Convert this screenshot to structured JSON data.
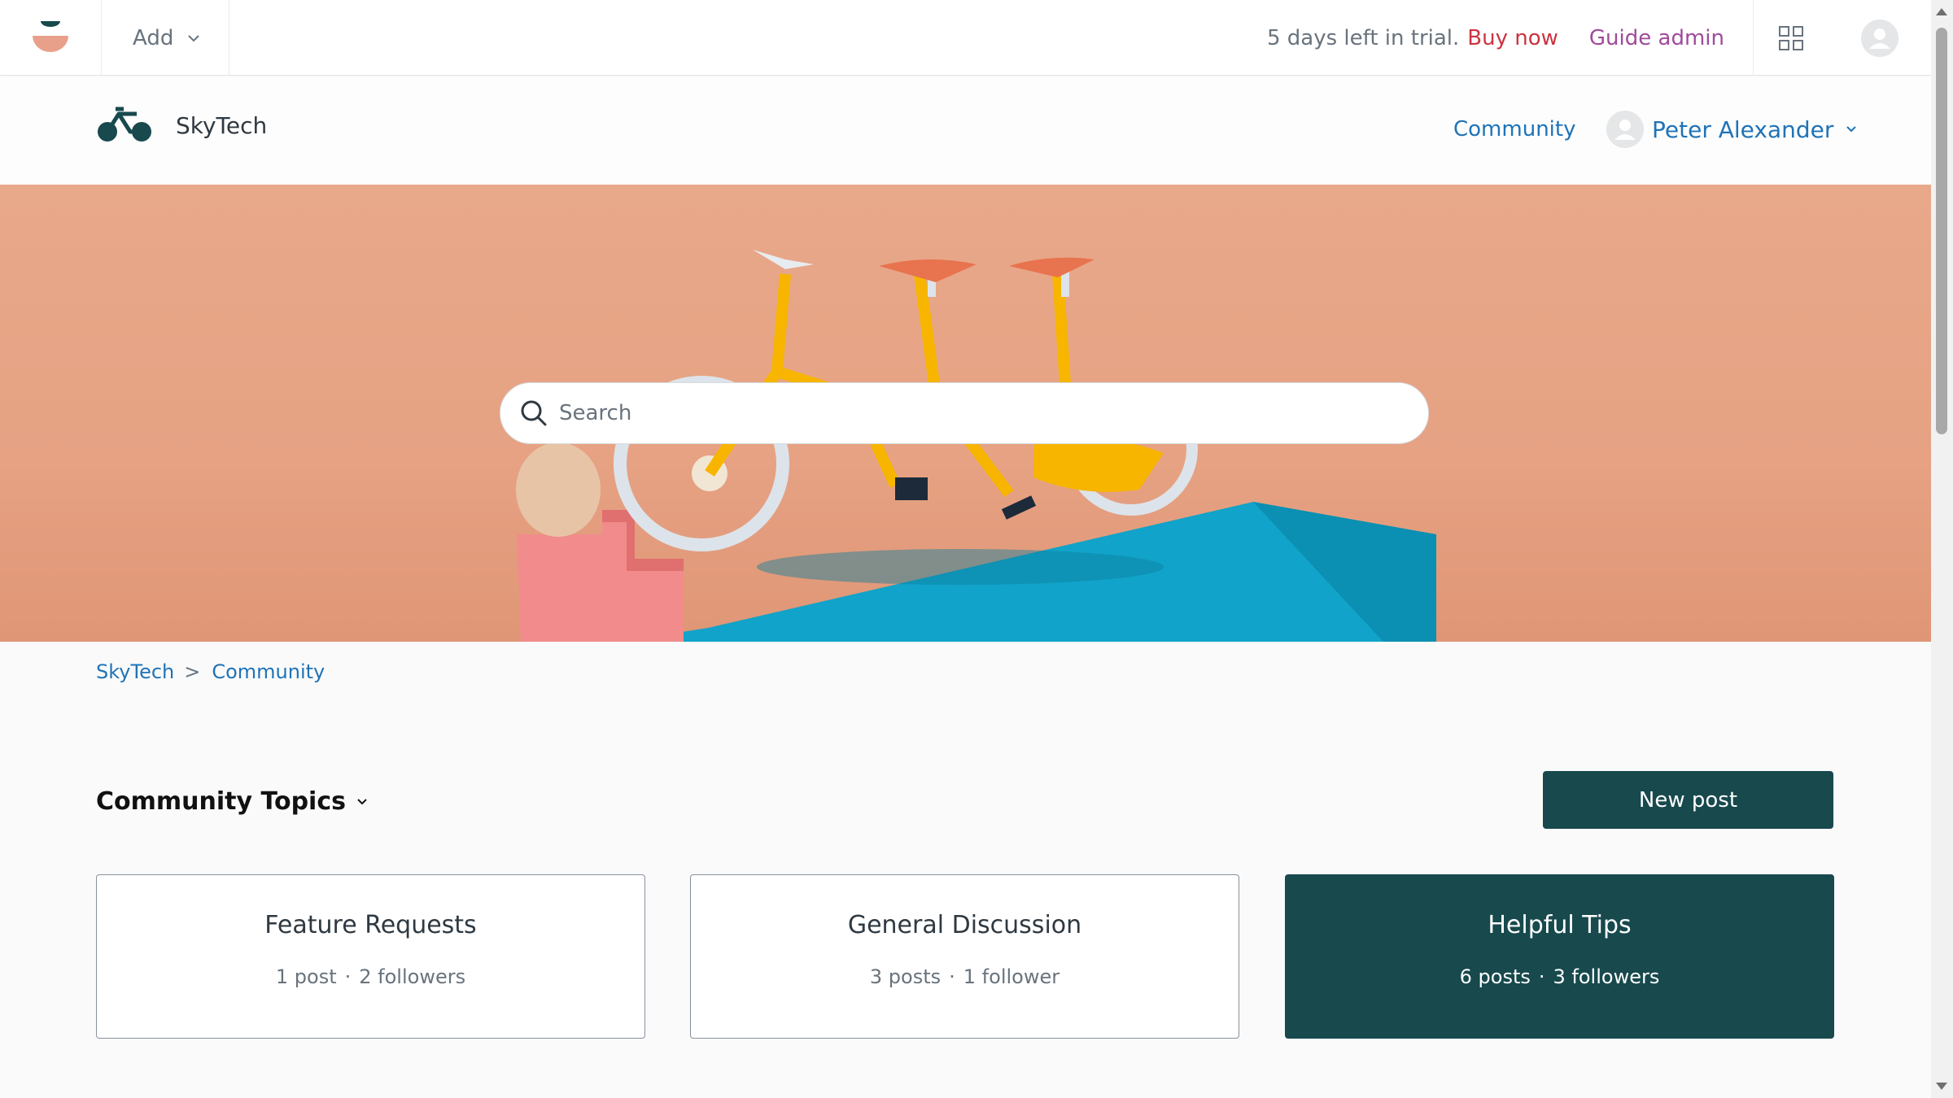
{
  "colors": {
    "brand_dark": "#17494d",
    "link": "#1f73b7",
    "buy_now": "#cc3340",
    "guide_admin": "#a04a9a",
    "hero_bg": "#e8a88a"
  },
  "adminbar": {
    "add_label": "Add",
    "trial_text": "5 days left in trial.",
    "buy_now": "Buy now",
    "guide_admin": "Guide admin",
    "icons": [
      "zendesk-logo-icon",
      "chevron-down-icon",
      "product-tray-icon",
      "user-avatar-icon"
    ]
  },
  "header": {
    "brand_name": "SkyTech",
    "nav_community": "Community",
    "user_name": "Peter Alexander"
  },
  "search": {
    "placeholder": "Search"
  },
  "breadcrumb": {
    "items": [
      "SkyTech",
      "Community"
    ],
    "separator": ">"
  },
  "topics": {
    "heading": "Community Topics",
    "new_post": "New post",
    "cards": [
      {
        "title": "Feature Requests",
        "posts": "1 post",
        "followers": "2 followers",
        "dot": "·"
      },
      {
        "title": "General Discussion",
        "posts": "3 posts",
        "followers": "1 follower",
        "dot": "·"
      },
      {
        "title": "Helpful Tips",
        "posts": "6 posts",
        "followers": "3 followers",
        "dot": "·"
      }
    ]
  }
}
